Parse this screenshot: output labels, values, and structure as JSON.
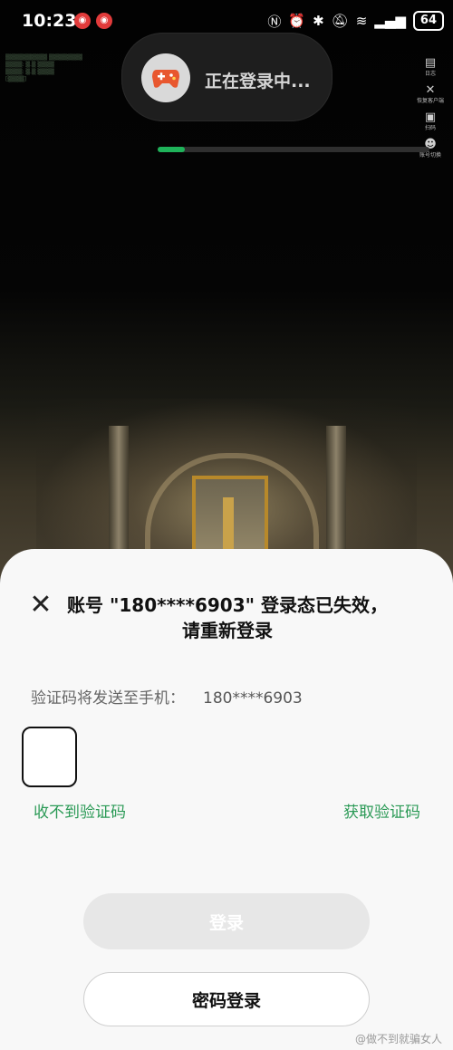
{
  "status_bar": {
    "time": "10:23",
    "battery": "64",
    "icons": [
      "nfc-icon",
      "alarm-icon",
      "bluetooth-icon",
      "mute-icon",
      "wifi-icon",
      "signal-icon"
    ]
  },
  "login_toast": {
    "text": "正在登录中...",
    "icon": "gamepad-icon",
    "progress": 0.1,
    "accent": "#1fb35a"
  },
  "game_overlay": {
    "side_tools": [
      "日志",
      "恢复客户端",
      "扫码",
      "账号切换"
    ]
  },
  "sheet": {
    "title": "账号 \"180****6903\" 登录态已失效，请重新登录",
    "hint_label": "验证码将发送至手机：",
    "hint_phone": "180****6903",
    "no_code_link": "收不到验证码",
    "get_code_link": "获取验证码",
    "login_button": "登录",
    "password_login_button": "密码登录",
    "accent": "#2b9a56"
  },
  "watermark": "@做不到就骗女人"
}
